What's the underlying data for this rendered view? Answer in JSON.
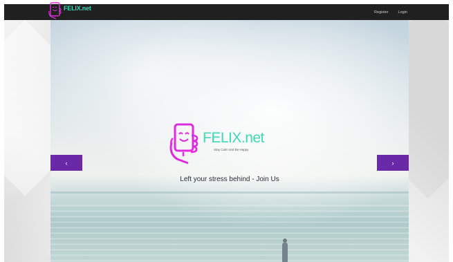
{
  "navbar": {
    "brand_text": "FELIX.net",
    "links": [
      {
        "label": "Register"
      },
      {
        "label": "Login"
      }
    ]
  },
  "hero": {
    "logo_title": "FELIX.net",
    "logo_tagline": "Stay Calm and Be Happy",
    "caption": "Left your stress behind - Join Us",
    "prev_arrow": "‹",
    "next_arrow": "›"
  },
  "colors": {
    "navbar_bg": "#202020",
    "brand_accent": "#3fd8b6",
    "logo_magenta": "#e02adf",
    "arrow_purple": "#6a2aa8"
  },
  "icons": {
    "brand": "felix-phone-logo-icon",
    "prev": "chevron-left-icon",
    "next": "chevron-right-icon"
  }
}
